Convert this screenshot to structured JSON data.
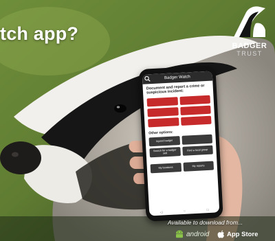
{
  "colors": {
    "accent_red": "#c62a2a",
    "button_dark": "#3a3a3a",
    "android_green": "#8bc34a"
  },
  "headline": "tch app?",
  "logo": {
    "line1": "BADGER",
    "line2": "TRUST"
  },
  "phone": {
    "app_title": "Badger Watch",
    "intro": "Document and report a crime or suspicious incident:",
    "report_buttons": [
      "",
      "",
      "",
      "",
      "",
      ""
    ],
    "other_heading": "Other options:",
    "option_buttons": [
      "Injured badger",
      "",
      "Search for a badger sett",
      "Find a local group"
    ],
    "bottom_buttons": [
      "My locations",
      "My reports"
    ],
    "nav_icons": [
      "back-icon",
      "home-icon",
      "recent-icon"
    ]
  },
  "download": {
    "tagline": "Available to download from...",
    "android_label": "android",
    "apple_label": "App Store"
  }
}
